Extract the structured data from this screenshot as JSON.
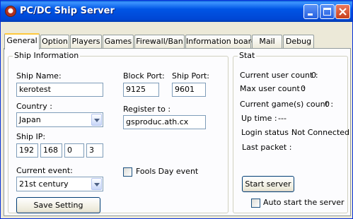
{
  "window": {
    "title": "PC/DC Ship Server",
    "title_bar_color": "#0055e5",
    "controls": [
      "minimize-icon",
      "maximize-icon",
      "close-icon"
    ]
  },
  "tabs": [
    {
      "label": "General",
      "active": true
    },
    {
      "label": "Option",
      "active": false
    },
    {
      "label": "Players",
      "active": false
    },
    {
      "label": "Games",
      "active": false
    },
    {
      "label": "Firewall/Ban",
      "active": false
    },
    {
      "label": "Information board",
      "active": false
    },
    {
      "label": "Mail",
      "active": false
    },
    {
      "label": "Debug",
      "active": false
    }
  ],
  "ship_info": {
    "legend": "Ship Information",
    "ship_name_label": "Ship Name:",
    "ship_name_value": "kerotest",
    "block_port_label": "Block Port:",
    "block_port_value": "9125",
    "ship_port_label": "Ship Port:",
    "ship_port_value": "9601",
    "country_label": "Country :",
    "country_value": "Japan",
    "register_label": "Register to :",
    "register_value": "gsproduc.ath.cx",
    "ship_ip_label": "Ship IP:",
    "ip": [
      "192",
      "168",
      "0",
      "3"
    ],
    "current_event_label": "Current event:",
    "current_event_value": "21st century",
    "fools_day_label": "Fools Day event",
    "fools_day_checked": false,
    "save_button": "Save Setting"
  },
  "stat": {
    "legend": "Stat",
    "current_user_label": "Current user count :",
    "current_user_value": "0",
    "max_user_label": "Max user count :",
    "max_user_value": "0",
    "current_games_label": "Current game(s) count :",
    "current_games_value": "0",
    "uptime_label": "Up time :",
    "uptime_value": "---",
    "login_status_label": "Login status :",
    "login_status_value": "Not Connected",
    "last_packet_label": "Last packet :",
    "last_packet_value": "",
    "start_button": "Start server",
    "auto_start_label": "Auto start the server",
    "auto_start_checked": false
  }
}
